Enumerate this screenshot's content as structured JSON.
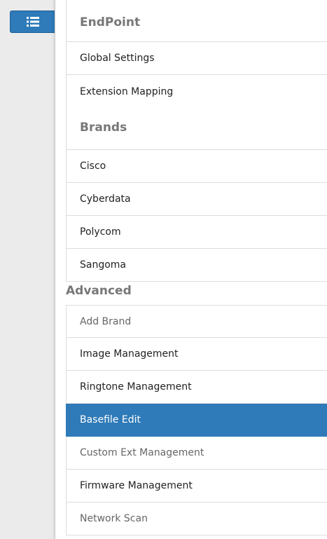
{
  "toggle": {
    "icon": "list-icon",
    "color": "#2f7ab8"
  },
  "sections": {
    "endpoint": {
      "title": "EndPoint",
      "items": [
        "Global Settings",
        "Extension Mapping"
      ]
    },
    "brands": {
      "title": "Brands",
      "items": [
        "Cisco",
        "Cyberdata",
        "Polycom",
        "Sangoma"
      ]
    },
    "advanced": {
      "title": "Advanced",
      "items": [
        "Add Brand",
        "Image Management",
        "Ringtone Management",
        "Basefile Edit",
        "Custom Ext Management",
        "Firmware Management",
        "Network Scan"
      ],
      "active": "Basefile Edit"
    }
  },
  "colors": {
    "accent": "#2f7ab8",
    "header_text": "#777777"
  }
}
